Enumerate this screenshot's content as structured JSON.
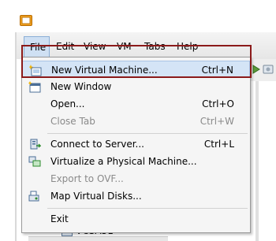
{
  "menubar": {
    "items": [
      {
        "label": "File"
      },
      {
        "label": "Edit"
      },
      {
        "label": "View"
      },
      {
        "label": "VM"
      },
      {
        "label": "Tabs"
      },
      {
        "label": "Help"
      }
    ]
  },
  "file_menu": {
    "items": [
      {
        "label": "New Virtual Machine...",
        "shortcut": "Ctrl+N",
        "icon": "new-vm-icon",
        "enabled": true,
        "highlighted": true
      },
      {
        "label": "New Window",
        "shortcut": "",
        "icon": "new-window-icon",
        "enabled": true
      },
      {
        "label": "Open...",
        "shortcut": "Ctrl+O",
        "icon": "",
        "enabled": true
      },
      {
        "label": "Close Tab",
        "shortcut": "Ctrl+W",
        "icon": "",
        "enabled": false
      },
      {
        "label": "Connect to Server...",
        "shortcut": "Ctrl+L",
        "icon": "connect-server-icon",
        "enabled": true
      },
      {
        "label": "Virtualize a Physical Machine...",
        "shortcut": "",
        "icon": "virtualize-icon",
        "enabled": true
      },
      {
        "label": "Export to OVF...",
        "shortcut": "",
        "icon": "",
        "enabled": false
      },
      {
        "label": "Map Virtual Disks...",
        "shortcut": "",
        "icon": "map-disks-icon",
        "enabled": true
      },
      {
        "label": "Exit",
        "shortcut": "",
        "icon": "",
        "enabled": true
      }
    ]
  },
  "tree": {
    "visible_item": "VCSA51"
  },
  "colors": {
    "highlight_outline": "#8b1a1a",
    "selected_item": "#d4e4f6"
  }
}
